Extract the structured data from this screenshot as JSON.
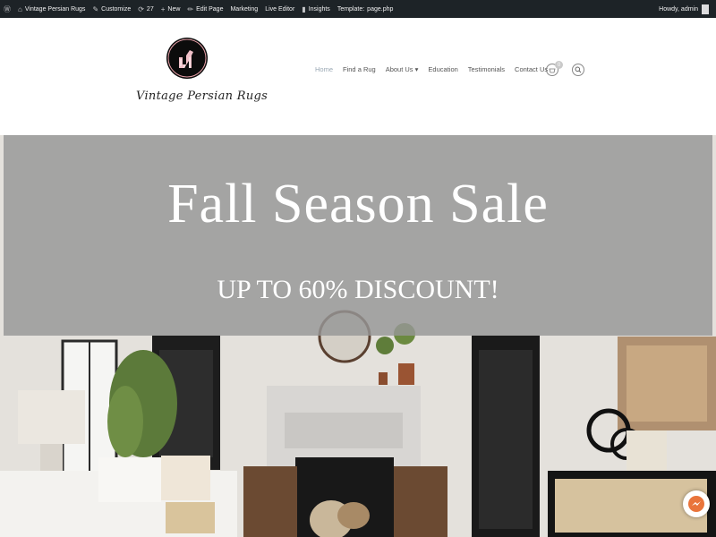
{
  "admin_bar": {
    "site_name": "Vintage Persian Rugs",
    "customize": "Customize",
    "updates_count": "27",
    "new": "New",
    "edit_page": "Edit Page",
    "marketing": "Marketing",
    "live_editor": "Live Editor",
    "insights": "Insights",
    "template_label": "Template:",
    "template_value": "page.php",
    "howdy": "Howdy, admin"
  },
  "header": {
    "logo_text": "Vintage Persian Rugs",
    "nav": [
      "Home",
      "Find a Rug",
      "About Us",
      "Education",
      "Testimonials",
      "Contact Us"
    ],
    "about_chevron": "▾",
    "cart_count": "0"
  },
  "hero": {
    "title": "Fall Season Sale",
    "subtitle": "UP TO 60% DISCOUNT!"
  },
  "colors": {
    "admin_bar_bg": "#1d2327",
    "banner_overlay": "#969696",
    "nav_active": "#9aa8b4",
    "chat_accent": "#e9743b"
  }
}
